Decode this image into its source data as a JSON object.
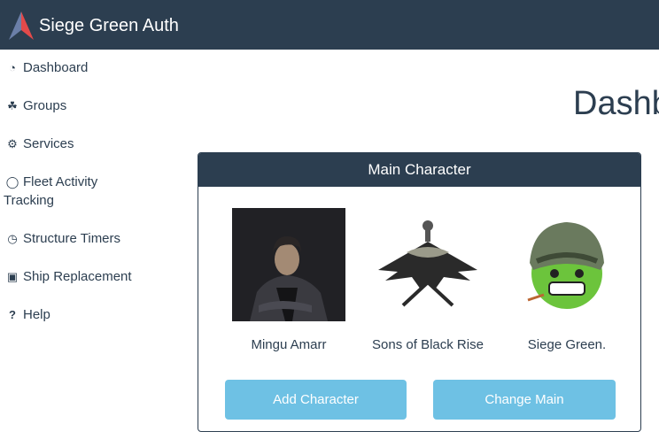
{
  "brand": {
    "name": "Siege Green Auth"
  },
  "sidebar": {
    "items": [
      {
        "label": "Dashboard",
        "icon": "dashboard-icon"
      },
      {
        "label": "Groups",
        "icon": "sitemap-icon"
      },
      {
        "label": "Services",
        "icon": "cogs-icon"
      },
      {
        "label_line1": "Fleet Activity",
        "label_line2": "Tracking",
        "icon": "lightbulb-icon"
      },
      {
        "label": "Structure Timers",
        "icon": "clock-icon"
      },
      {
        "label": "Ship Replacement",
        "icon": "money-icon"
      },
      {
        "label": "Help",
        "icon": "question-icon"
      }
    ]
  },
  "page": {
    "title": "Dashb"
  },
  "main_character": {
    "heading": "Main Character",
    "character": "Mingu Amarr",
    "corporation": "Sons of Black Rise",
    "alliance": "Siege Green.",
    "add_label": "Add Character",
    "change_label": "Change Main"
  },
  "colors": {
    "navbar": "#2c3e50",
    "button": "#6ec1e4",
    "text": "#2c3e50"
  }
}
